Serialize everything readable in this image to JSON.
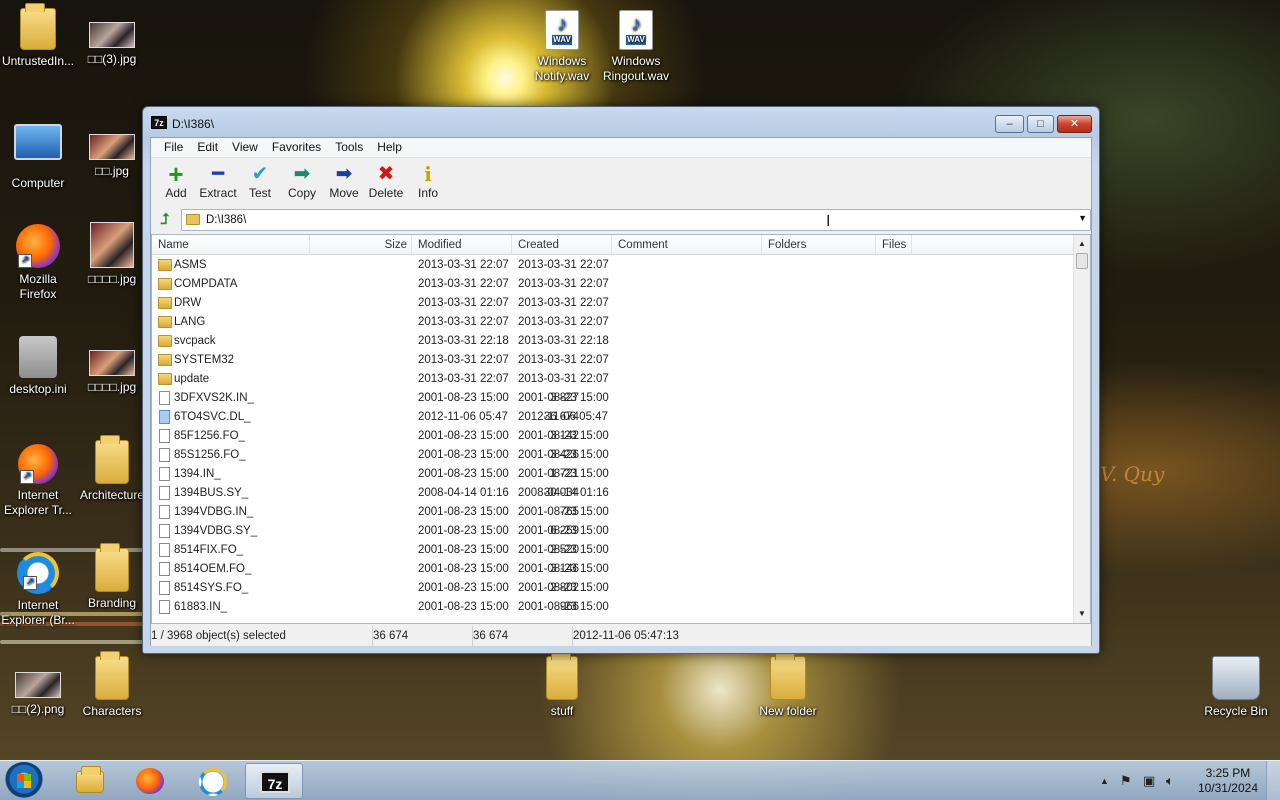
{
  "desktop": {
    "icons": [
      {
        "label": "UntrustedIn...",
        "kind": "folder-user"
      },
      {
        "label": "□□(3).jpg",
        "kind": "image"
      },
      {
        "label": "Windows Notify.wav",
        "kind": "wav"
      },
      {
        "label": "Windows Ringout.wav",
        "kind": "wav"
      },
      {
        "label": "Computer",
        "kind": "computer"
      },
      {
        "label": "□□.jpg",
        "kind": "image"
      },
      {
        "label": "Mozilla Firefox",
        "kind": "firefox-shortcut"
      },
      {
        "label": "□□□□.jpg",
        "kind": "image"
      },
      {
        "label": "desktop.ini",
        "kind": "ini"
      },
      {
        "label": "□□□□.jpg",
        "kind": "image"
      },
      {
        "label": "Internet Explorer Tr...",
        "kind": "ie-shortcut"
      },
      {
        "label": "Architecture",
        "kind": "folder"
      },
      {
        "label": "Internet Explorer (Br...",
        "kind": "ie-shortcut"
      },
      {
        "label": "Branding",
        "kind": "folder"
      },
      {
        "label": "□□(2).png",
        "kind": "image"
      },
      {
        "label": "Characters",
        "kind": "folder"
      },
      {
        "label": "stuff",
        "kind": "folder"
      },
      {
        "label": "New folder",
        "kind": "folder"
      },
      {
        "label": "Recycle Bin",
        "kind": "recycle-bin"
      }
    ],
    "wav_badge": "WAV"
  },
  "window": {
    "app_icon": "7z",
    "title": "D:\\I386\\",
    "controls": {
      "minimize": "–",
      "maximize": "□",
      "close": "✕"
    },
    "menu": [
      "File",
      "Edit",
      "View",
      "Favorites",
      "Tools",
      "Help"
    ],
    "toolbar": [
      {
        "label": "Add",
        "icon": "plus-icon",
        "glyph": "+",
        "color": "#1a9a1a"
      },
      {
        "label": "Extract",
        "icon": "minus-icon",
        "glyph": "━",
        "color": "#1d3fbf"
      },
      {
        "label": "Test",
        "icon": "check-icon",
        "glyph": "✔",
        "color": "#21a7b8"
      },
      {
        "label": "Copy",
        "icon": "copy-arrow-icon",
        "glyph": "➡",
        "color": "#1f8a6e"
      },
      {
        "label": "Move",
        "icon": "move-arrow-icon",
        "glyph": "➡",
        "color": "#1c3f9a"
      },
      {
        "label": "Delete",
        "icon": "delete-x-icon",
        "glyph": "✖",
        "color": "#d01818"
      },
      {
        "label": "Info",
        "icon": "info-icon",
        "glyph": "i",
        "color": "#c9a400"
      }
    ],
    "address": "D:\\I386\\",
    "columns": {
      "name": "Name",
      "size": "Size",
      "modified": "Modified",
      "created": "Created",
      "comment": "Comment",
      "folders": "Folders",
      "files": "Files"
    },
    "rows": [
      {
        "type": "folder",
        "name": "ASMS",
        "size": "",
        "modified": "2013-03-31 22:07",
        "created": "2013-03-31 22:07"
      },
      {
        "type": "folder",
        "name": "COMPDATA",
        "size": "",
        "modified": "2013-03-31 22:07",
        "created": "2013-03-31 22:07"
      },
      {
        "type": "folder",
        "name": "DRW",
        "size": "",
        "modified": "2013-03-31 22:07",
        "created": "2013-03-31 22:07"
      },
      {
        "type": "folder",
        "name": "LANG",
        "size": "",
        "modified": "2013-03-31 22:07",
        "created": "2013-03-31 22:07"
      },
      {
        "type": "folder",
        "name": "svcpack",
        "size": "",
        "modified": "2013-03-31 22:18",
        "created": "2013-03-31 22:18"
      },
      {
        "type": "folder",
        "name": "SYSTEM32",
        "size": "",
        "modified": "2013-03-31 22:07",
        "created": "2013-03-31 22:07"
      },
      {
        "type": "folder",
        "name": "update",
        "size": "",
        "modified": "2013-03-31 22:07",
        "created": "2013-03-31 22:07"
      },
      {
        "type": "file",
        "name": "3DFXVS2K.IN_",
        "size": "3 827",
        "modified": "2001-08-23 15:00",
        "created": "2001-08-23 15:00"
      },
      {
        "type": "file-selected",
        "name": "6TO4SVC.DL_",
        "size": "36 674",
        "modified": "2012-11-06 05:47",
        "created": "2012-11-06 05:47"
      },
      {
        "type": "file",
        "name": "85F1256.FO_",
        "size": "3 142",
        "modified": "2001-08-23 15:00",
        "created": "2001-08-23 15:00"
      },
      {
        "type": "file",
        "name": "85S1256.FO_",
        "size": "3 426",
        "modified": "2001-08-23 15:00",
        "created": "2001-08-23 15:00"
      },
      {
        "type": "file",
        "name": "1394.IN_",
        "size": "1 721",
        "modified": "2001-08-23 15:00",
        "created": "2001-08-23 15:00"
      },
      {
        "type": "file",
        "name": "1394BUS.SY_",
        "size": "30 034",
        "modified": "2008-04-14 01:16",
        "created": "2008-04-14 01:16"
      },
      {
        "type": "file",
        "name": "1394VDBG.IN_",
        "size": "765",
        "modified": "2001-08-23 15:00",
        "created": "2001-08-23 15:00"
      },
      {
        "type": "file",
        "name": "1394VDBG.SY_",
        "size": "6 259",
        "modified": "2001-08-23 15:00",
        "created": "2001-08-23 15:00"
      },
      {
        "type": "file",
        "name": "8514FIX.FO_",
        "size": "2 520",
        "modified": "2001-08-23 15:00",
        "created": "2001-08-23 15:00"
      },
      {
        "type": "file",
        "name": "8514OEM.FO_",
        "size": "3 146",
        "modified": "2001-08-23 15:00",
        "created": "2001-08-23 15:00"
      },
      {
        "type": "file",
        "name": "8514SYS.FO_",
        "size": "2 802",
        "modified": "2001-08-23 15:00",
        "created": "2001-08-23 15:00"
      },
      {
        "type": "file",
        "name": "61883.IN_",
        "size": "966",
        "modified": "2001-08-23 15:00",
        "created": "2001-08-23 15:00"
      }
    ],
    "status": {
      "selection": "1 / 3968 object(s) selected",
      "size": "36 674",
      "packed": "36 674",
      "date": "2012-11-06 05:47:13"
    }
  },
  "taskbar": {
    "apps": [
      {
        "name": "explorer",
        "icon": "folder-icon"
      },
      {
        "name": "firefox",
        "icon": "firefox-icon"
      },
      {
        "name": "internet-explorer",
        "icon": "ie-icon"
      },
      {
        "name": "7zip",
        "icon": "7zip-icon",
        "label": "7z",
        "active": true
      }
    ],
    "time": "3:25 PM",
    "date": "10/31/2024"
  }
}
